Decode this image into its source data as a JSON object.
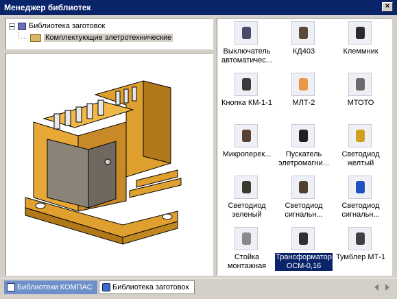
{
  "window": {
    "title": "Менеджер библиотек",
    "close": "×"
  },
  "tree": {
    "root_label": "Библиотека заготовок",
    "child_label": "Комплектующие элетротехнические"
  },
  "gallery": {
    "items": [
      {
        "label": "Выключатель автоматичес...",
        "icon": "circuit-breaker-icon"
      },
      {
        "label": "КД403",
        "icon": "diode-block-icon"
      },
      {
        "label": "Клеммник",
        "icon": "terminal-block-icon"
      },
      {
        "label": "Кнопка КМ-1-1",
        "icon": "push-button-icon"
      },
      {
        "label": "МЛТ-2",
        "icon": "resistor-icon"
      },
      {
        "label": "МТОТО",
        "icon": "switch-icon"
      },
      {
        "label": "Микроперек...",
        "icon": "micro-switch-icon"
      },
      {
        "label": "Пускатель элетромагни...",
        "icon": "contactor-icon"
      },
      {
        "label": "Светодиод желтый",
        "icon": "led-yellow-icon"
      },
      {
        "label": "Светодиод зеленый",
        "icon": "led-green-icon"
      },
      {
        "label": "Светодиод сигнальн...",
        "icon": "led-signal-icon"
      },
      {
        "label": "Светодиод сигнальн...",
        "icon": "led-signal-blue-icon"
      },
      {
        "label": "Стойка монтажная",
        "icon": "mounting-post-icon"
      },
      {
        "label": "Трансформатор ОСМ-0,16",
        "icon": "transformer-icon",
        "selected": true
      },
      {
        "label": "Тумблер МТ-1",
        "icon": "toggle-switch-icon"
      }
    ]
  },
  "tabs": {
    "compas": "Библиотеки КОМПАС",
    "blanks": "Библиотека заготовок"
  },
  "colors": {
    "titlebar": "#0a246a",
    "selection": "#0a246a",
    "transformer_body": "#e0a030"
  }
}
